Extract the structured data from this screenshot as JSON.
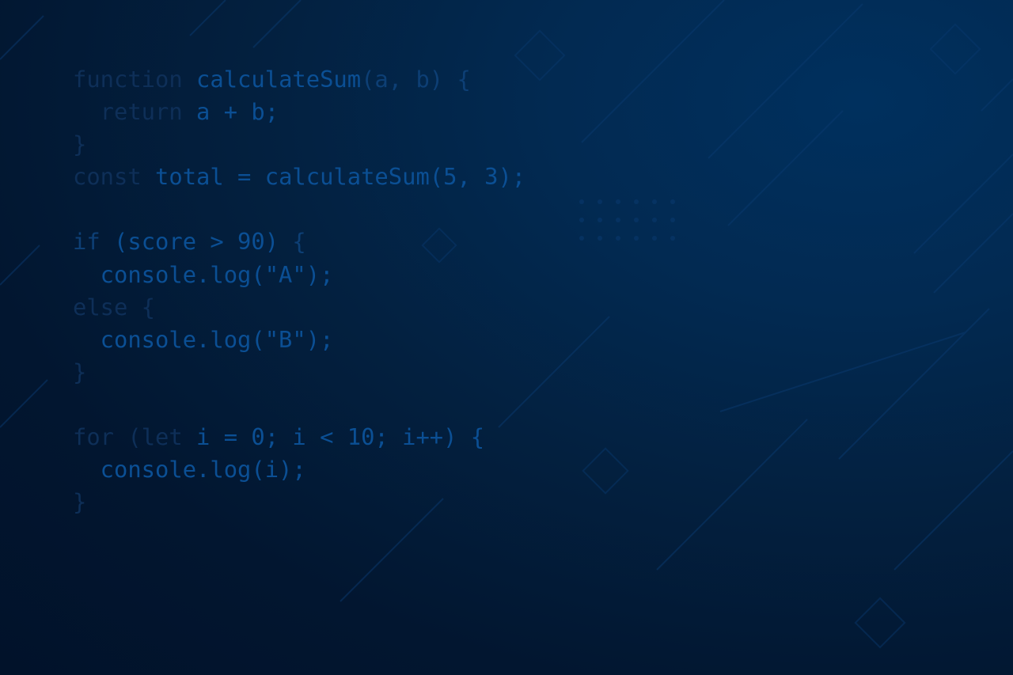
{
  "code_lines": [
    [
      {
        "t": "function ",
        "c": "dim"
      },
      {
        "t": "calculateSum",
        "c": "bright"
      },
      {
        "t": "(a, b) {",
        "c": "mid"
      }
    ],
    [
      {
        "t": "  return ",
        "c": "dim"
      },
      {
        "t": "a + b;",
        "c": "bright"
      }
    ],
    [
      {
        "t": "}",
        "c": "dim"
      }
    ],
    [
      {
        "t": "const ",
        "c": "dim"
      },
      {
        "t": "total = calculateSum(5, 3);",
        "c": "bright"
      }
    ],
    [],
    [
      {
        "t": "if ",
        "c": "mid"
      },
      {
        "t": "(score > 90) ",
        "c": "bright"
      },
      {
        "t": "{",
        "c": "mid"
      }
    ],
    [
      {
        "t": "  console.log(\"A\");",
        "c": "bright"
      }
    ],
    [
      {
        "t": "else {",
        "c": "dim"
      }
    ],
    [
      {
        "t": "  console.log(\"B\");",
        "c": "bright"
      }
    ],
    [
      {
        "t": "}",
        "c": "dim"
      }
    ],
    [],
    [
      {
        "t": "for ",
        "c": "dim"
      },
      {
        "t": "(let ",
        "c": "dim"
      },
      {
        "t": "i = 0; i < 10; i++) {",
        "c": "bright"
      }
    ],
    [
      {
        "t": "  console.log(i);",
        "c": "bright"
      }
    ],
    [
      {
        "t": "}",
        "c": "dim"
      }
    ]
  ],
  "colors": {
    "background": "#01122a",
    "accent": "#0b4f94"
  }
}
